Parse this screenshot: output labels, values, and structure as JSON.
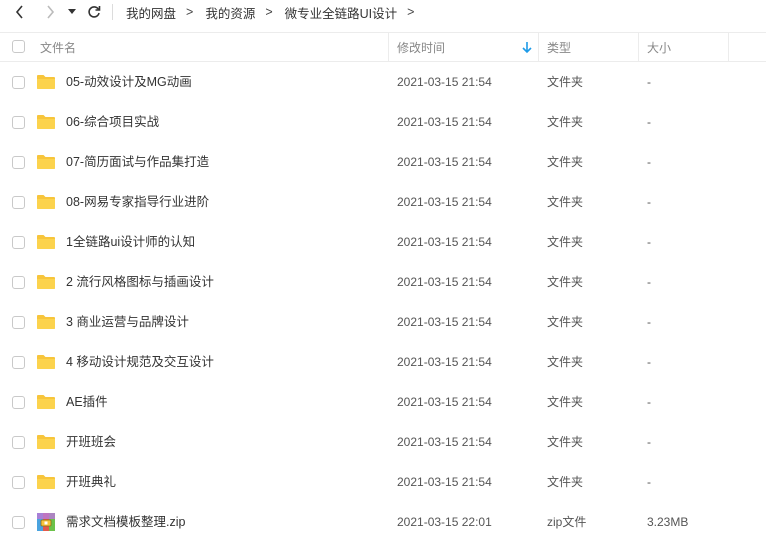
{
  "breadcrumb": {
    "items": [
      "我的网盘",
      "我的资源",
      "微专业全链路UI设计"
    ],
    "separator": ">"
  },
  "header": {
    "name": "文件名",
    "mtime": "修改时间",
    "type": "类型",
    "size": "大小"
  },
  "colors": {
    "folder": "#f7c53b",
    "accent": "#1e9be8"
  },
  "files": [
    {
      "name": "05-动效设计及MG动画",
      "mtime": "2021-03-15 21:54",
      "type": "文件夹",
      "size": "-",
      "icon": "folder-icon"
    },
    {
      "name": "06-综合项目实战",
      "mtime": "2021-03-15 21:54",
      "type": "文件夹",
      "size": "-",
      "icon": "folder-icon"
    },
    {
      "name": "07-简历面试与作品集打造",
      "mtime": "2021-03-15 21:54",
      "type": "文件夹",
      "size": "-",
      "icon": "folder-icon"
    },
    {
      "name": "08-网易专家指导行业进阶",
      "mtime": "2021-03-15 21:54",
      "type": "文件夹",
      "size": "-",
      "icon": "folder-icon"
    },
    {
      "name": "1全链路ui设计师的认知",
      "mtime": "2021-03-15 21:54",
      "type": "文件夹",
      "size": "-",
      "icon": "folder-icon"
    },
    {
      "name": "2 流行风格图标与插画设计",
      "mtime": "2021-03-15 21:54",
      "type": "文件夹",
      "size": "-",
      "icon": "folder-icon"
    },
    {
      "name": "3 商业运营与品牌设计",
      "mtime": "2021-03-15 21:54",
      "type": "文件夹",
      "size": "-",
      "icon": "folder-icon"
    },
    {
      "name": "4 移动设计规范及交互设计",
      "mtime": "2021-03-15 21:54",
      "type": "文件夹",
      "size": "-",
      "icon": "folder-icon"
    },
    {
      "name": "AE插件",
      "mtime": "2021-03-15 21:54",
      "type": "文件夹",
      "size": "-",
      "icon": "folder-icon"
    },
    {
      "name": "开班班会",
      "mtime": "2021-03-15 21:54",
      "type": "文件夹",
      "size": "-",
      "icon": "folder-icon"
    },
    {
      "name": "开班典礼",
      "mtime": "2021-03-15 21:54",
      "type": "文件夹",
      "size": "-",
      "icon": "folder-icon"
    },
    {
      "name": "需求文档模板整理.zip",
      "mtime": "2021-03-15 22:01",
      "type": "zip文件",
      "size": "3.23MB",
      "icon": "zip-archive-icon"
    }
  ]
}
